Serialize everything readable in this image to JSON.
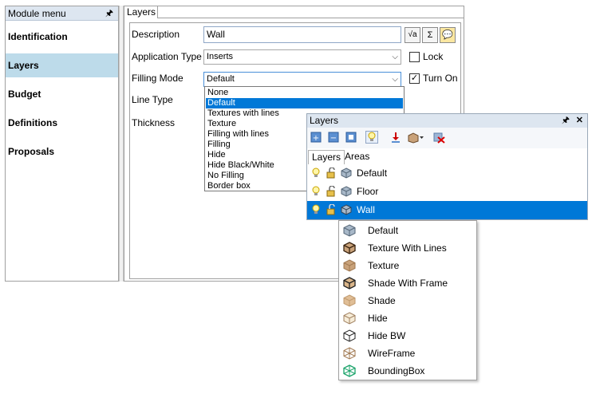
{
  "module_menu": {
    "title": "Module menu",
    "pin_glyph": "🖈",
    "items": [
      {
        "label": "Identification",
        "selected": false
      },
      {
        "label": "Layers",
        "selected": true
      },
      {
        "label": "Budget",
        "selected": false
      },
      {
        "label": "Definitions",
        "selected": false
      },
      {
        "label": "Proposals",
        "selected": false
      }
    ]
  },
  "layers_form": {
    "tab": "Layers",
    "description": {
      "label": "Description",
      "value": "Wall"
    },
    "buttons": {
      "formula": "√a",
      "sum": "Σ",
      "comment": "💬"
    },
    "application_type": {
      "label": "Application Type",
      "value": "Inserts"
    },
    "lock": {
      "label": "Lock",
      "checked": false
    },
    "filling_mode": {
      "label": "Filling Mode",
      "value": "Default"
    },
    "turn_on": {
      "label": "Turn On",
      "checked": true
    },
    "line_type": {
      "label": "Line Type"
    },
    "thickness": {
      "label": "Thickness"
    }
  },
  "filling_options": [
    {
      "label": "None",
      "selected": false
    },
    {
      "label": "Default",
      "selected": true
    },
    {
      "label": "Textures with lines",
      "selected": false
    },
    {
      "label": "Texture",
      "selected": false
    },
    {
      "label": "Filling with lines",
      "selected": false
    },
    {
      "label": "Filling",
      "selected": false
    },
    {
      "label": "Hide",
      "selected": false
    },
    {
      "label": "Hide Black/White",
      "selected": false
    },
    {
      "label": "No Filling",
      "selected": false
    },
    {
      "label": "Border box",
      "selected": false
    }
  ],
  "layers_window": {
    "title": "Layers",
    "pin_glyph": "🖈",
    "close_glyph": "✕",
    "tabs": [
      {
        "label": "Layers",
        "active": true
      },
      {
        "label": "Areas",
        "active": false
      }
    ],
    "rows": [
      {
        "name": "Default",
        "selected": false
      },
      {
        "name": "Floor",
        "selected": false
      },
      {
        "name": "Wall",
        "selected": true
      }
    ]
  },
  "mode_menu": [
    {
      "label": "Default",
      "icon": "cube-gray-icon"
    },
    {
      "label": "Texture With Lines",
      "icon": "cube-texture-lines-icon"
    },
    {
      "label": "Texture",
      "icon": "cube-texture-icon"
    },
    {
      "label": "Shade With Frame",
      "icon": "cube-shade-frame-icon"
    },
    {
      "label": "Shade",
      "icon": "cube-shade-icon"
    },
    {
      "label": "Hide",
      "icon": "cube-hide-icon"
    },
    {
      "label": "Hide BW",
      "icon": "cube-hide-bw-icon"
    },
    {
      "label": "WireFrame",
      "icon": "cube-wireframe-icon"
    },
    {
      "label": "BoundingBox",
      "icon": "cube-boundingbox-icon"
    }
  ],
  "colors": {
    "selection": "#0078d7",
    "module_selected": "#bddbea",
    "header": "#dde6f0"
  }
}
